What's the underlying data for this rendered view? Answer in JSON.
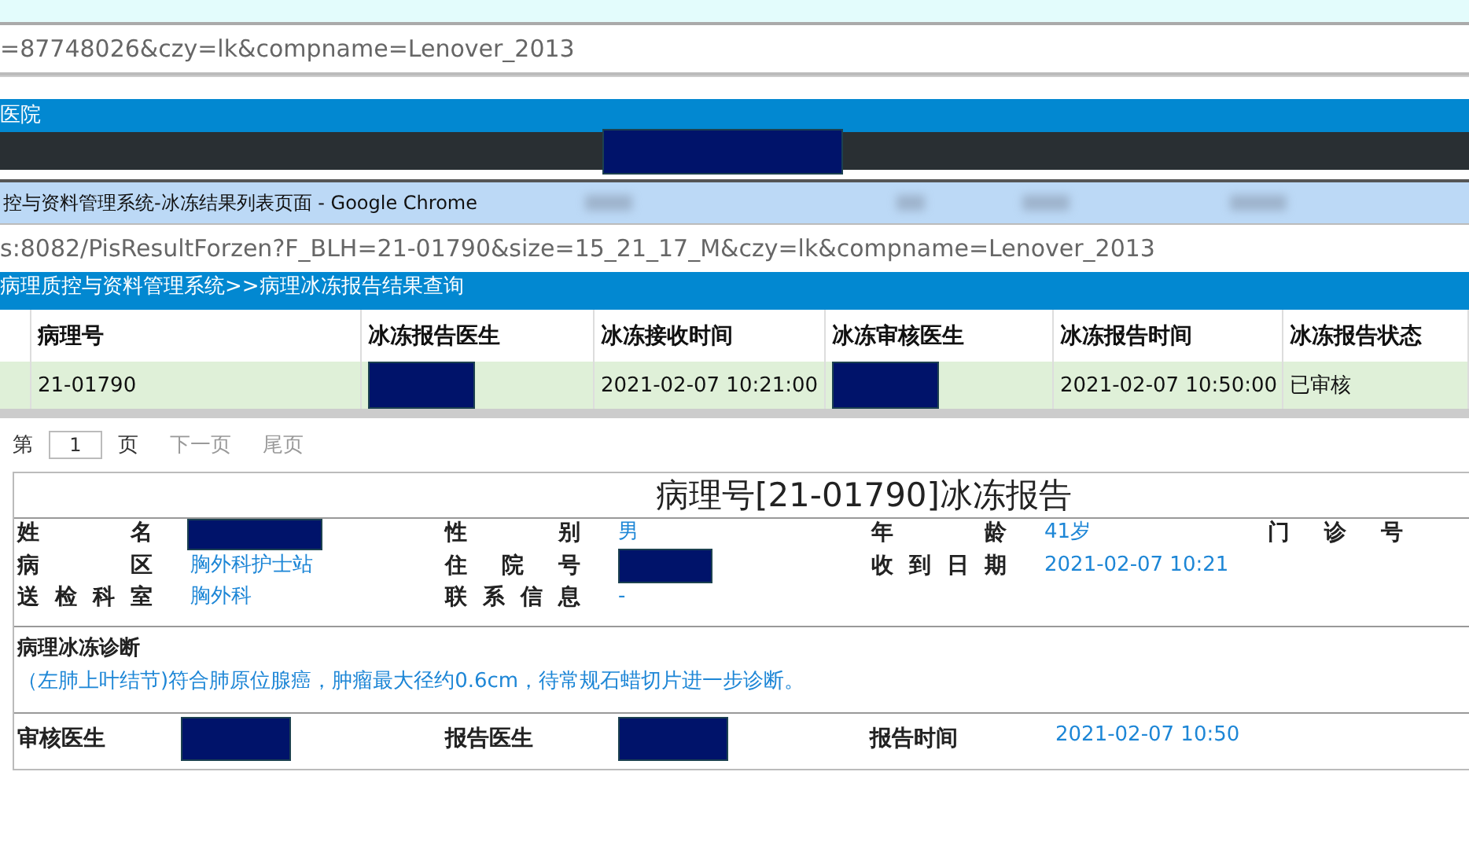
{
  "back_window": {
    "address": "=87748026&czy=lk&compname=Lenover_2013",
    "header_title": "医院",
    "header_redacted": true
  },
  "front_window": {
    "title": "控与资料管理系统-冰冻结果列表页面 - Google Chrome",
    "address": "s:8082/PisResultForzen?F_BLH=21-01790&size=15_21_17_M&czy=lk&compname=Lenover_2013",
    "breadcrumb": "病理质控与资料管理系统>>病理冰冻报告结果查询"
  },
  "table": {
    "columns": [
      "病理号",
      "冰冻报告医生",
      "冰冻接收时间",
      "冰冻审核医生",
      "冰冻报告时间",
      "冰冻报告状态"
    ],
    "rows": [
      {
        "selected": true,
        "cells": [
          {
            "text": "21-01790",
            "redacted": false
          },
          {
            "redacted": true
          },
          {
            "text": "2021-02-07 10:21:00",
            "redacted": false
          },
          {
            "redacted": true
          },
          {
            "text": "2021-02-07 10:50:00",
            "redacted": false
          },
          {
            "text": "已审核",
            "redacted": false
          }
        ]
      }
    ]
  },
  "pager": {
    "prefix": "第",
    "page": "1",
    "suffix": "页",
    "next": "下一页",
    "last": "尾页"
  },
  "report": {
    "title": "病理号[21-01790]冰冻报告",
    "field_rows": [
      [
        {
          "label": "姓 名",
          "redacted": true
        },
        {
          "label": "性 别",
          "value": "男",
          "redacted": false
        },
        {
          "label": "年 龄",
          "value": "41岁",
          "redacted": false
        },
        {
          "label": "门 诊 号",
          "redacted": false
        }
      ],
      [
        {
          "label": "病 区",
          "value": "胸外科护士站",
          "redacted": false
        },
        {
          "label": "住 院 号",
          "redacted": true
        },
        {
          "label": "收到日期",
          "value": "2021-02-07 10:21",
          "redacted": false
        }
      ],
      [
        {
          "label": "送检科室",
          "value": "胸外科",
          "redacted": false
        },
        {
          "label": "联系信息",
          "value": "-",
          "redacted": false
        }
      ]
    ],
    "diagnosis_label": "病理冰冻诊断",
    "diagnosis": "（左肺上叶结节)符合肺原位腺癌，肿瘤最大径约0.6cm，待常规石蜡切片进一步诊断。",
    "signatures": [
      {
        "label": "审核医生",
        "redacted": true
      },
      {
        "label": "报告医生",
        "redacted": true
      },
      {
        "label": "报告时间",
        "value": "2021-02-07 10:50",
        "redacted": false
      }
    ]
  }
}
